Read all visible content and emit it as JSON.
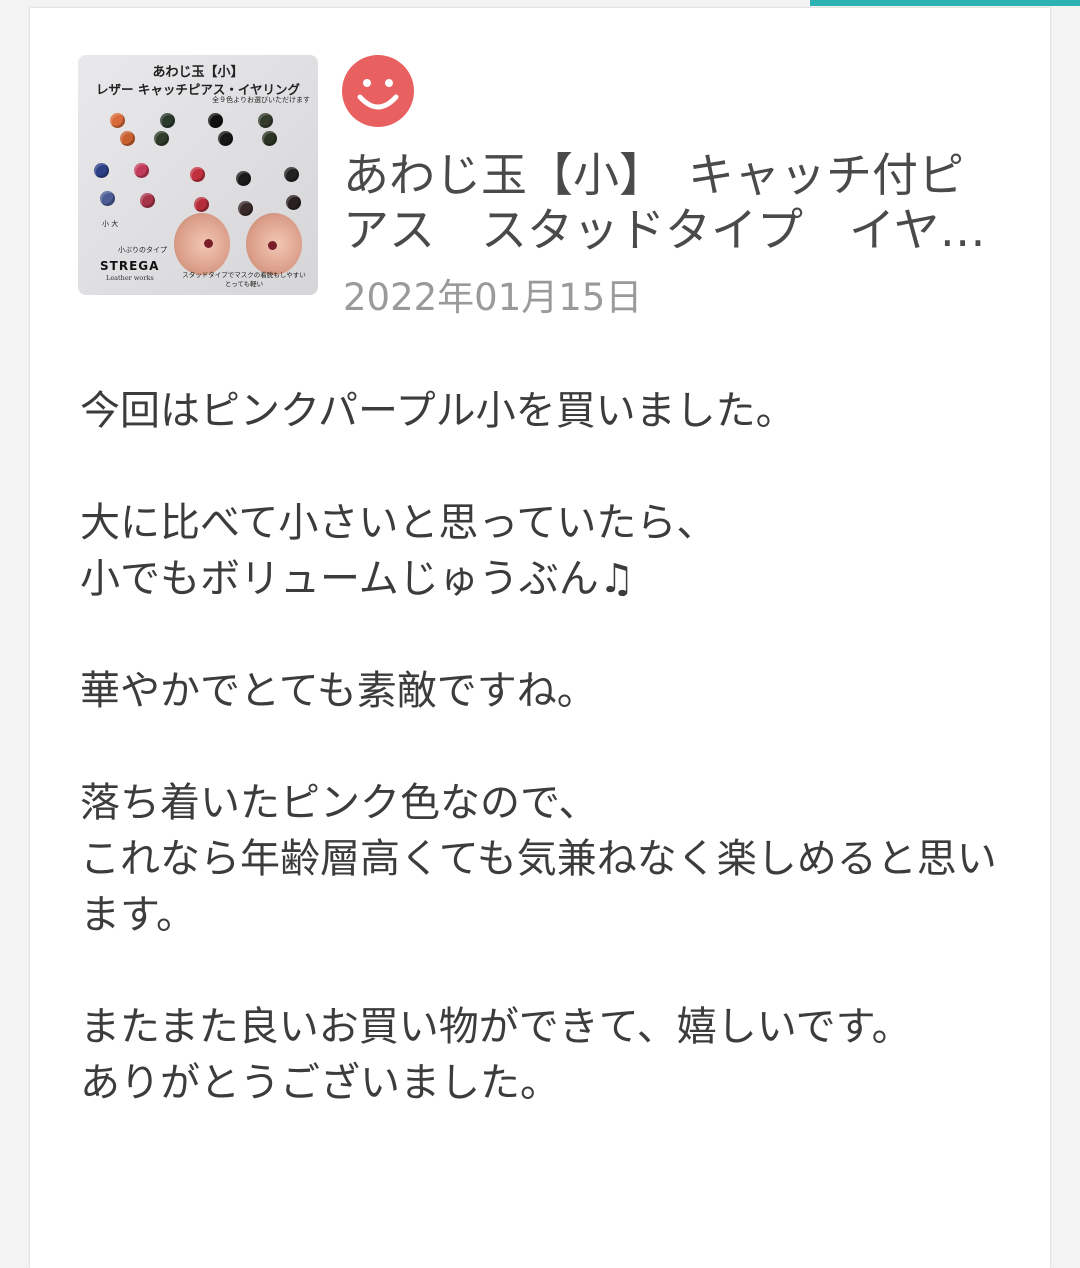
{
  "product": {
    "image_alt": "あわじ玉【小】レザー キャッチピアス・イヤリング",
    "image_text": {
      "line1": "あわじ玉【小】",
      "line2": "レザー キャッチピアス・イヤリング",
      "line3": "全９色よりお選びいただけます",
      "size_tag": "小 大",
      "caption_small": "小ぶりのタイプ",
      "brand": "STREGA",
      "brand_sub": "Leather works",
      "caption_bottom": "スタッドタイプでマスクの着脱もしやすい\nとっても軽い"
    },
    "title": "あわじ玉【小】　キャッチ付ピアス　スタッドタイプ　イヤリング",
    "date": "2022年01月15日"
  },
  "reviewer": {
    "avatar_icon": "smiley-face-icon",
    "avatar_color": "#e8605f"
  },
  "review": {
    "text": "今回はピンクパープル小を買いました。\n\n大に比べて小さいと思っていたら、\n小でもボリュームじゅうぶん♫\n\n華やかでとても素敵ですね。\n\n落ち着いたピンク色なので、\nこれなら年齢層高くても気兼ねなく楽しめると思います。\n\nまたまた良いお買い物ができて、嬉しいです。\nありがとうございました。"
  },
  "colors": {
    "accent": "#2bb3b3",
    "text": "#3c3c3c",
    "muted": "#9a9a9a",
    "knots": [
      "#d96a3a",
      "#2a3a2c",
      "#111111",
      "#333b2c",
      "#2d3f86",
      "#c23a5c",
      "#a8344a",
      "#1b1b1b",
      "#4a5b95",
      "#3a2a2a"
    ]
  }
}
